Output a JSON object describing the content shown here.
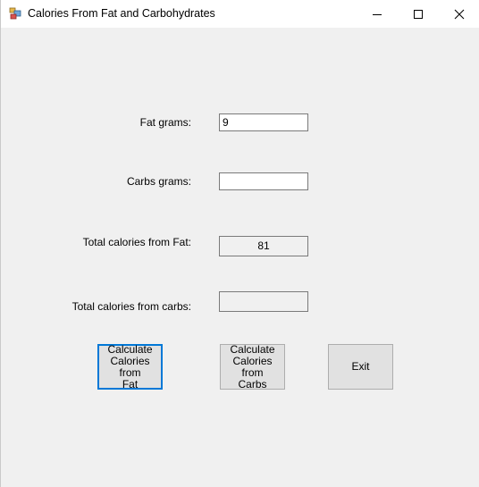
{
  "window": {
    "title": "Calories From Fat and Carbohydrates",
    "controls": {
      "minimize": "minimize",
      "maximize": "maximize",
      "close": "close"
    }
  },
  "form": {
    "fat_label": "Fat grams:",
    "fat_value": "9",
    "carbs_label": "Carbs grams:",
    "carbs_value": "",
    "fat_total_label": "Total calories from Fat:",
    "fat_total_value": "81",
    "carbs_total_label": "Total calories from carbs:",
    "carbs_total_value": ""
  },
  "buttons": {
    "calc_fat": "Calculate\nCalories from\nFat",
    "calc_carbs": "Calculate\nCalories from\nCarbs",
    "exit": "Exit"
  },
  "colors": {
    "focus_border": "#0078d7",
    "window_bg": "#f0f0f0",
    "button_bg": "#e1e1e1"
  }
}
